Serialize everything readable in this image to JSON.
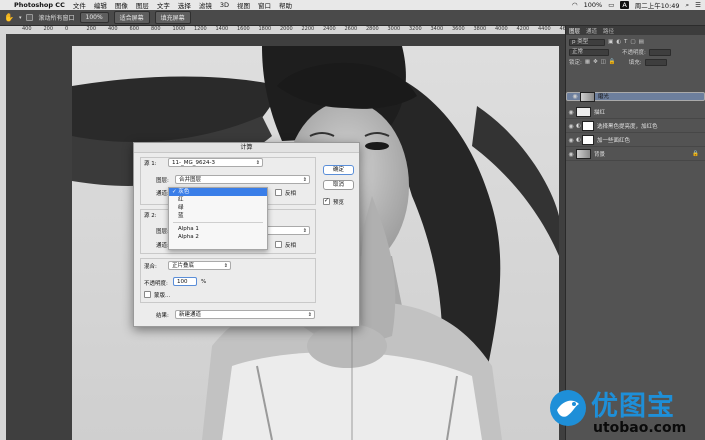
{
  "menubar": {
    "app": "Photoshop CC",
    "items": [
      "文件",
      "编辑",
      "图像",
      "图层",
      "文字",
      "选择",
      "滤镜",
      "3D",
      "视图",
      "窗口",
      "帮助"
    ],
    "battery": "100%",
    "input_method": "A",
    "clock": "周二上午10:49"
  },
  "options": {
    "scroll_all": "滚动所有窗口",
    "btn_100": "100%",
    "btn_fit": "适合屏幕",
    "btn_fill": "填充屏幕"
  },
  "ruler": [
    "400",
    "200",
    "0",
    "200",
    "400",
    "600",
    "800",
    "1000",
    "1200",
    "1400",
    "1600",
    "1800",
    "2000",
    "2200",
    "2400",
    "2600",
    "2800",
    "3000",
    "3200",
    "3400",
    "3600",
    "3800",
    "4000",
    "4200",
    "4400",
    "4600",
    "4800"
  ],
  "panel": {
    "tabs": [
      "图层",
      "通道",
      "路径"
    ],
    "kind_label": "p 类型",
    "blend_mode": "正常",
    "opacity_label": "不透明度:",
    "fill_label": "填充:",
    "lock_label": "锁定:",
    "layers": [
      {
        "name": "磨光",
        "selected": true
      },
      {
        "name": "描红",
        "selected": false
      },
      {
        "name": "选择黑色提亮度，加红色",
        "selected": false
      },
      {
        "name": "加一些面红色",
        "selected": false
      },
      {
        "name": "背景",
        "selected": false
      }
    ]
  },
  "dialog": {
    "title": "计算",
    "source1_label": "源 1:",
    "source1_value": "11-_MG_9624-3",
    "layer1_label": "图层:",
    "layer1_value": "合并图层",
    "channel1_label": "通道:",
    "invert1_label": "反相",
    "source2_label": "源 2:",
    "layer2_label": "图层:",
    "channel2_label": "通道:",
    "invert2_label": "反相",
    "blend_label": "混合:",
    "blend_value": "正片叠底",
    "opacity_label": "不透明度:",
    "opacity_value": "100",
    "opacity_unit": "%",
    "mask_label": "蒙版...",
    "result_label": "结果:",
    "result_value": "新建通道",
    "ok_label": "确定",
    "cancel_label": "取消",
    "preview_label": "预览",
    "preview_checked": true
  },
  "dropdown": {
    "items": [
      "灰色",
      "红",
      "绿",
      "蓝"
    ],
    "alpha_items": [
      "Alpha 1",
      "Alpha 2"
    ],
    "selected": "灰色"
  },
  "watermark": {
    "title": "优图宝",
    "url": "utobao.com"
  },
  "colors": {
    "accent": "#3a7ee8",
    "layer_selected": "#6d7f9d",
    "watermark_blue": "#1e8fd8"
  }
}
